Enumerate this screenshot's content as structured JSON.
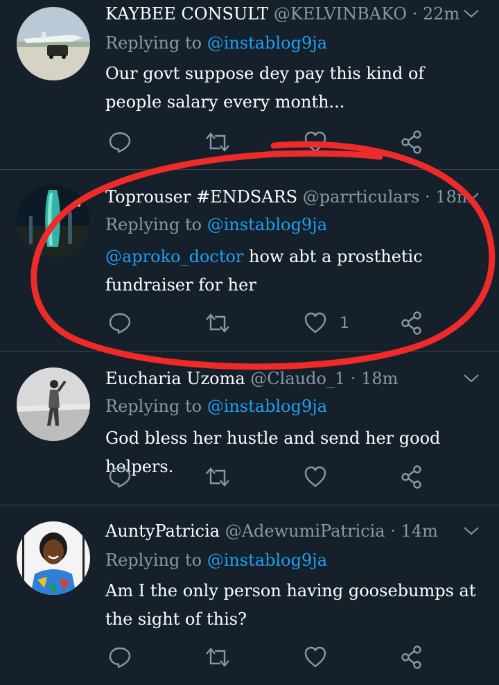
{
  "colors": {
    "background": "#15202b",
    "text_primary": "#ffffff",
    "text_secondary": "#8899a6",
    "link": "#1da1f2",
    "divider": "#38444d",
    "annotation": "#ee2a2a"
  },
  "tweets": [
    {
      "name": "KAYBEE CONSULT",
      "handle": "@KELVINBAKO",
      "dot": "·",
      "time": "22m",
      "replying_prefix": "Replying to",
      "replying_to": "@instablog9ja",
      "mention": "",
      "text": "Our govt suppose dey pay this kind of people salary every month...",
      "like_count": "",
      "avatar": "jet-and-car-photo"
    },
    {
      "name": "Toprouser #ENDSARS",
      "handle": "@parrticulars",
      "dot": "·",
      "time": "18m",
      "replying_prefix": "Replying to",
      "replying_to": "@instablog9ja",
      "mention": "@aproko_doctor",
      "text": "how abt a prosthetic fundraiser for her",
      "like_count": "1",
      "avatar": "night-tower-photo"
    },
    {
      "name": "Eucharia Uzoma",
      "handle": "@Claudo_1",
      "dot": "·",
      "time": "18m",
      "replying_prefix": "Replying to",
      "replying_to": "@instablog9ja",
      "mention": "",
      "text": "God bless her hustle and send her good helpers.",
      "like_count": "",
      "avatar": "beach-person-photo"
    },
    {
      "name": "AuntyPatricia",
      "handle": "@AdewumiPatricia",
      "dot": "·",
      "time": "14m",
      "replying_prefix": "Replying to",
      "replying_to": "@instablog9ja",
      "mention": "",
      "text": "Am I the only person having goosebumps at the sight of this?",
      "like_count": "",
      "avatar": "smiling-woman-photo"
    }
  ],
  "icons": {
    "reply": "reply-icon",
    "retweet": "retweet-icon",
    "like": "heart-icon",
    "share": "share-icon",
    "menu": "chevron-down-icon"
  }
}
